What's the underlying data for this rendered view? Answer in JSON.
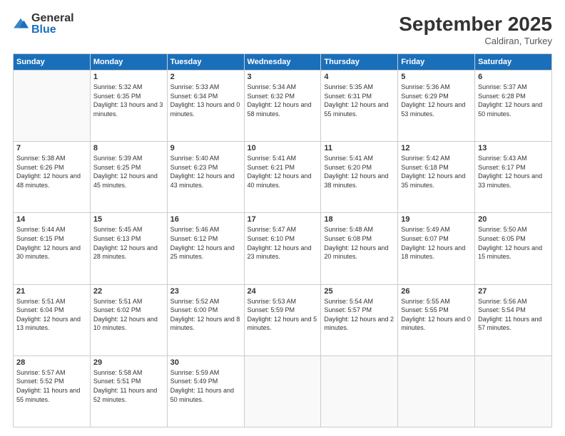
{
  "header": {
    "logo_general": "General",
    "logo_blue": "Blue",
    "month_title": "September 2025",
    "location": "Caldiran, Turkey"
  },
  "weekdays": [
    "Sunday",
    "Monday",
    "Tuesday",
    "Wednesday",
    "Thursday",
    "Friday",
    "Saturday"
  ],
  "weeks": [
    [
      {
        "day": "",
        "sunrise": "",
        "sunset": "",
        "daylight": ""
      },
      {
        "day": "1",
        "sunrise": "Sunrise: 5:32 AM",
        "sunset": "Sunset: 6:35 PM",
        "daylight": "Daylight: 13 hours and 3 minutes."
      },
      {
        "day": "2",
        "sunrise": "Sunrise: 5:33 AM",
        "sunset": "Sunset: 6:34 PM",
        "daylight": "Daylight: 13 hours and 0 minutes."
      },
      {
        "day": "3",
        "sunrise": "Sunrise: 5:34 AM",
        "sunset": "Sunset: 6:32 PM",
        "daylight": "Daylight: 12 hours and 58 minutes."
      },
      {
        "day": "4",
        "sunrise": "Sunrise: 5:35 AM",
        "sunset": "Sunset: 6:31 PM",
        "daylight": "Daylight: 12 hours and 55 minutes."
      },
      {
        "day": "5",
        "sunrise": "Sunrise: 5:36 AM",
        "sunset": "Sunset: 6:29 PM",
        "daylight": "Daylight: 12 hours and 53 minutes."
      },
      {
        "day": "6",
        "sunrise": "Sunrise: 5:37 AM",
        "sunset": "Sunset: 6:28 PM",
        "daylight": "Daylight: 12 hours and 50 minutes."
      }
    ],
    [
      {
        "day": "7",
        "sunrise": "Sunrise: 5:38 AM",
        "sunset": "Sunset: 6:26 PM",
        "daylight": "Daylight: 12 hours and 48 minutes."
      },
      {
        "day": "8",
        "sunrise": "Sunrise: 5:39 AM",
        "sunset": "Sunset: 6:25 PM",
        "daylight": "Daylight: 12 hours and 45 minutes."
      },
      {
        "day": "9",
        "sunrise": "Sunrise: 5:40 AM",
        "sunset": "Sunset: 6:23 PM",
        "daylight": "Daylight: 12 hours and 43 minutes."
      },
      {
        "day": "10",
        "sunrise": "Sunrise: 5:41 AM",
        "sunset": "Sunset: 6:21 PM",
        "daylight": "Daylight: 12 hours and 40 minutes."
      },
      {
        "day": "11",
        "sunrise": "Sunrise: 5:41 AM",
        "sunset": "Sunset: 6:20 PM",
        "daylight": "Daylight: 12 hours and 38 minutes."
      },
      {
        "day": "12",
        "sunrise": "Sunrise: 5:42 AM",
        "sunset": "Sunset: 6:18 PM",
        "daylight": "Daylight: 12 hours and 35 minutes."
      },
      {
        "day": "13",
        "sunrise": "Sunrise: 5:43 AM",
        "sunset": "Sunset: 6:17 PM",
        "daylight": "Daylight: 12 hours and 33 minutes."
      }
    ],
    [
      {
        "day": "14",
        "sunrise": "Sunrise: 5:44 AM",
        "sunset": "Sunset: 6:15 PM",
        "daylight": "Daylight: 12 hours and 30 minutes."
      },
      {
        "day": "15",
        "sunrise": "Sunrise: 5:45 AM",
        "sunset": "Sunset: 6:13 PM",
        "daylight": "Daylight: 12 hours and 28 minutes."
      },
      {
        "day": "16",
        "sunrise": "Sunrise: 5:46 AM",
        "sunset": "Sunset: 6:12 PM",
        "daylight": "Daylight: 12 hours and 25 minutes."
      },
      {
        "day": "17",
        "sunrise": "Sunrise: 5:47 AM",
        "sunset": "Sunset: 6:10 PM",
        "daylight": "Daylight: 12 hours and 23 minutes."
      },
      {
        "day": "18",
        "sunrise": "Sunrise: 5:48 AM",
        "sunset": "Sunset: 6:08 PM",
        "daylight": "Daylight: 12 hours and 20 minutes."
      },
      {
        "day": "19",
        "sunrise": "Sunrise: 5:49 AM",
        "sunset": "Sunset: 6:07 PM",
        "daylight": "Daylight: 12 hours and 18 minutes."
      },
      {
        "day": "20",
        "sunrise": "Sunrise: 5:50 AM",
        "sunset": "Sunset: 6:05 PM",
        "daylight": "Daylight: 12 hours and 15 minutes."
      }
    ],
    [
      {
        "day": "21",
        "sunrise": "Sunrise: 5:51 AM",
        "sunset": "Sunset: 6:04 PM",
        "daylight": "Daylight: 12 hours and 13 minutes."
      },
      {
        "day": "22",
        "sunrise": "Sunrise: 5:51 AM",
        "sunset": "Sunset: 6:02 PM",
        "daylight": "Daylight: 12 hours and 10 minutes."
      },
      {
        "day": "23",
        "sunrise": "Sunrise: 5:52 AM",
        "sunset": "Sunset: 6:00 PM",
        "daylight": "Daylight: 12 hours and 8 minutes."
      },
      {
        "day": "24",
        "sunrise": "Sunrise: 5:53 AM",
        "sunset": "Sunset: 5:59 PM",
        "daylight": "Daylight: 12 hours and 5 minutes."
      },
      {
        "day": "25",
        "sunrise": "Sunrise: 5:54 AM",
        "sunset": "Sunset: 5:57 PM",
        "daylight": "Daylight: 12 hours and 2 minutes."
      },
      {
        "day": "26",
        "sunrise": "Sunrise: 5:55 AM",
        "sunset": "Sunset: 5:55 PM",
        "daylight": "Daylight: 12 hours and 0 minutes."
      },
      {
        "day": "27",
        "sunrise": "Sunrise: 5:56 AM",
        "sunset": "Sunset: 5:54 PM",
        "daylight": "Daylight: 11 hours and 57 minutes."
      }
    ],
    [
      {
        "day": "28",
        "sunrise": "Sunrise: 5:57 AM",
        "sunset": "Sunset: 5:52 PM",
        "daylight": "Daylight: 11 hours and 55 minutes."
      },
      {
        "day": "29",
        "sunrise": "Sunrise: 5:58 AM",
        "sunset": "Sunset: 5:51 PM",
        "daylight": "Daylight: 11 hours and 52 minutes."
      },
      {
        "day": "30",
        "sunrise": "Sunrise: 5:59 AM",
        "sunset": "Sunset: 5:49 PM",
        "daylight": "Daylight: 11 hours and 50 minutes."
      },
      {
        "day": "",
        "sunrise": "",
        "sunset": "",
        "daylight": ""
      },
      {
        "day": "",
        "sunrise": "",
        "sunset": "",
        "daylight": ""
      },
      {
        "day": "",
        "sunrise": "",
        "sunset": "",
        "daylight": ""
      },
      {
        "day": "",
        "sunrise": "",
        "sunset": "",
        "daylight": ""
      }
    ]
  ]
}
